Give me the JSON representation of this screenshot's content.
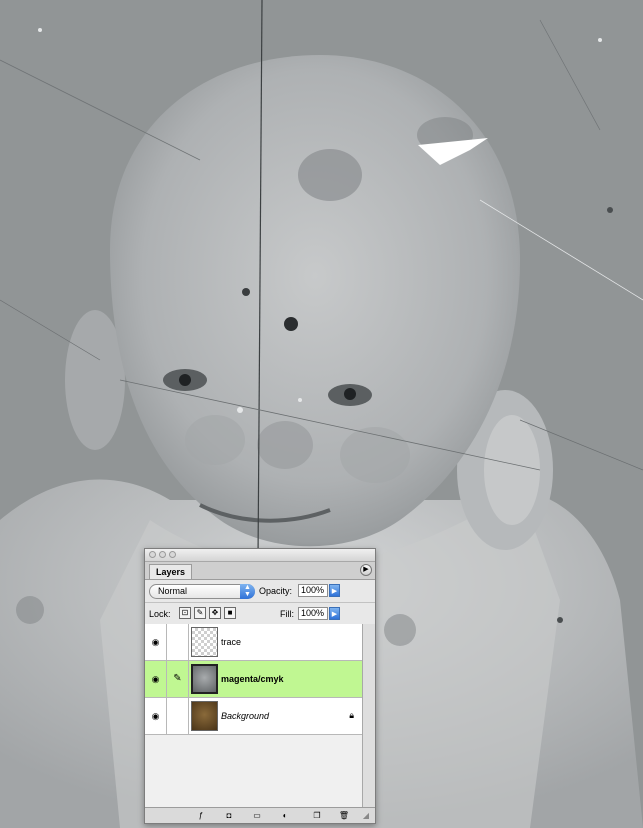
{
  "panel": {
    "tab_label": "Layers",
    "blend_mode": "Normal",
    "opacity_label": "Opacity:",
    "opacity_value": "100%",
    "lock_label": "Lock:",
    "fill_label": "Fill:",
    "fill_value": "100%"
  },
  "layers": [
    {
      "name": "trace",
      "visible": true,
      "selected": false,
      "thumbnail": "transparent-checker",
      "locked": false
    },
    {
      "name": "magenta/cmyk",
      "visible": true,
      "selected": true,
      "thumbnail": "grey-photo",
      "locked": false
    },
    {
      "name": "Background",
      "visible": true,
      "selected": false,
      "thumbnail": "brown-photo",
      "locked": true
    }
  ],
  "colors": {
    "selected_row": "#c0f792",
    "row": "#ffffff",
    "photo_bg": "#8f9395",
    "accent_blue": "#2f72d8"
  }
}
